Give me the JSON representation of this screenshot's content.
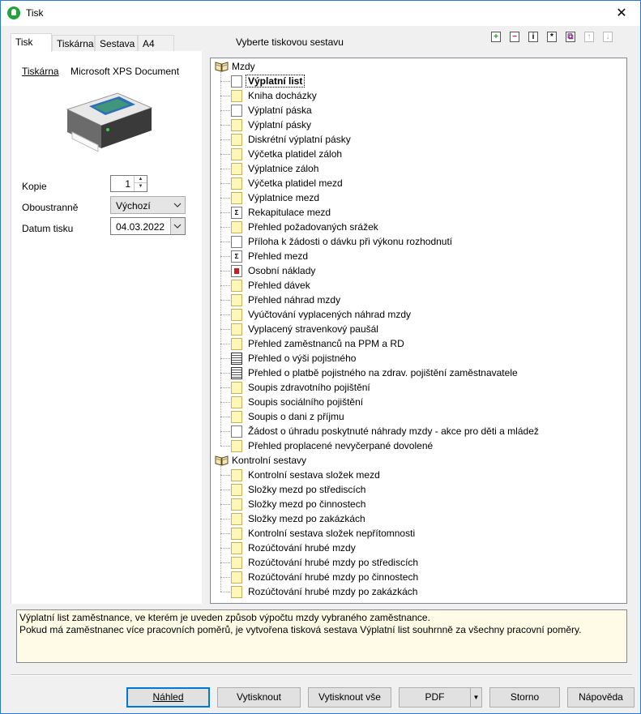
{
  "window": {
    "title": "Tisk",
    "close": "✕"
  },
  "tabs": [
    "Tisk",
    "Tiskárna",
    "Sestava",
    "A4"
  ],
  "printer_panel": {
    "printer_label": "Tiskárna",
    "printer_name": "Microsoft XPS Document",
    "copies_label": "Kopie",
    "copies_value": "1",
    "duplex_label": "Oboustranně",
    "duplex_value": "Výchozí",
    "date_label": "Datum tisku",
    "date_value": "04.03.2022"
  },
  "report_heading": "Vyberte tiskovou sestavu",
  "toolbar_icons": [
    "add-icon",
    "remove-icon",
    "info-icon",
    "properties-icon",
    "copy-icon",
    "move-up-icon",
    "move-down-icon"
  ],
  "tree": {
    "groups": [
      {
        "label": "Mzdy",
        "items": [
          {
            "label": "Výplatní list",
            "icon": "page",
            "selected": true
          },
          {
            "label": "Kniha docházky",
            "icon": "folder"
          },
          {
            "label": "Výplatní páska",
            "icon": "page"
          },
          {
            "label": "Výplatní pásky",
            "icon": "folder"
          },
          {
            "label": "Diskrétní výplatní pásky",
            "icon": "folder"
          },
          {
            "label": "Výčetka platidel záloh",
            "icon": "folder"
          },
          {
            "label": "Výplatnice záloh",
            "icon": "folder"
          },
          {
            "label": "Výčetka platidel mezd",
            "icon": "folder"
          },
          {
            "label": "Výplatnice mezd",
            "icon": "folder"
          },
          {
            "label": "Rekapitulace mezd",
            "icon": "sum"
          },
          {
            "label": "Přehled požadovaných srážek",
            "icon": "folder"
          },
          {
            "label": "Příloha k žádosti o dávku při výkonu rozhodnutí",
            "icon": "page"
          },
          {
            "label": "Přehled mezd",
            "icon": "sum"
          },
          {
            "label": "Osobní náklady",
            "icon": "red"
          },
          {
            "label": "Přehled dávek",
            "icon": "folder"
          },
          {
            "label": "Přehled náhrad mzdy",
            "icon": "folder"
          },
          {
            "label": "Vyúčtování vyplacených náhrad mzdy",
            "icon": "folder"
          },
          {
            "label": "Vyplacený stravenkový paušál",
            "icon": "folder"
          },
          {
            "label": "Přehled zaměstnanců na PPM a RD",
            "icon": "folder"
          },
          {
            "label": "Přehled o výši pojistného",
            "icon": "lines"
          },
          {
            "label": "Přehled o platbě pojistného na zdrav. pojištění zaměstnavatele",
            "icon": "lines"
          },
          {
            "label": "Soupis zdravotního pojištění",
            "icon": "folder"
          },
          {
            "label": "Soupis sociálního pojištění",
            "icon": "folder"
          },
          {
            "label": "Soupis o dani z příjmu",
            "icon": "folder"
          },
          {
            "label": "Žádost o úhradu poskytnuté náhrady mzdy - akce pro děti a mládež",
            "icon": "page"
          },
          {
            "label": "Přehled proplacené nevyčerpané dovolené",
            "icon": "folder"
          }
        ]
      },
      {
        "label": "Kontrolní sestavy",
        "items": [
          {
            "label": "Kontrolní sestava složek mezd",
            "icon": "folder"
          },
          {
            "label": "Složky mezd po střediscích",
            "icon": "folder"
          },
          {
            "label": "Složky mezd po činnostech",
            "icon": "folder"
          },
          {
            "label": "Složky mezd po zakázkách",
            "icon": "folder"
          },
          {
            "label": "Kontrolní sestava složek nepřítomnosti",
            "icon": "folder"
          },
          {
            "label": "Rozúčtování hrubé mzdy",
            "icon": "folder"
          },
          {
            "label": "Rozúčtování hrubé mzdy po střediscích",
            "icon": "folder"
          },
          {
            "label": "Rozúčtování hrubé mzdy po činnostech",
            "icon": "folder"
          },
          {
            "label": "Rozúčtování hrubé mzdy po zakázkách",
            "icon": "folder"
          }
        ]
      }
    ]
  },
  "description": [
    "Výplatní list zaměstnance, ve kterém je uveden způsob výpočtu mzdy vybraného zaměstnance.",
    "Pokud má zaměstnanec více pracovních poměrů, je vytvořena tisková sestava Výplatní list souhrnně za všechny pracovní poměry."
  ],
  "buttons": {
    "preview": "Náhled",
    "print": "Vytisknout",
    "print_all": "Vytisknout vše",
    "pdf": "PDF",
    "cancel": "Storno",
    "help": "Nápověda"
  }
}
